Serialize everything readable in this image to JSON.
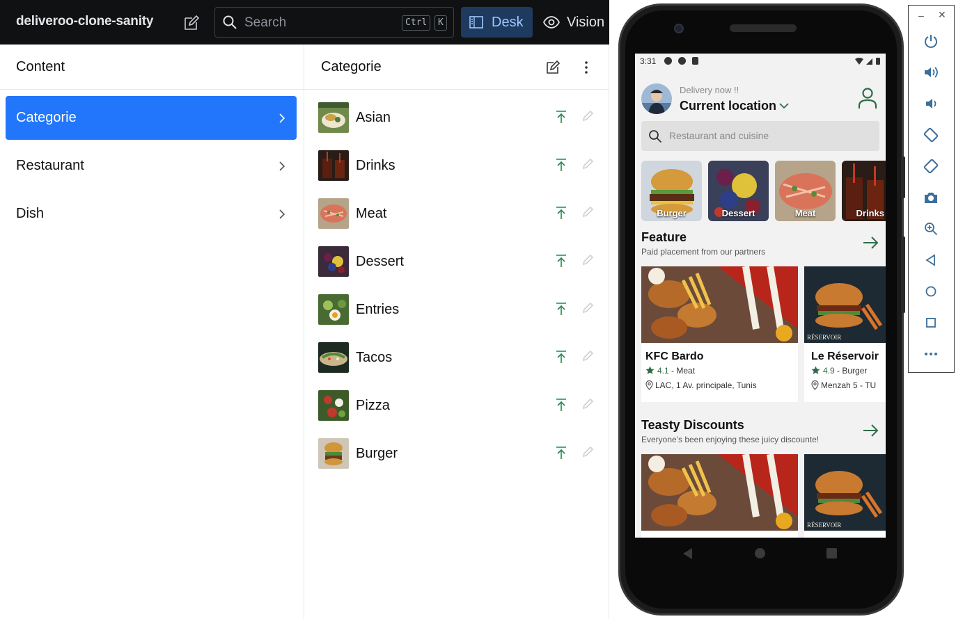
{
  "studio": {
    "project": "deliveroo-clone-sanity",
    "search_placeholder": "Search",
    "shortcut_ctrl": "Ctrl",
    "shortcut_k": "K",
    "desk_label": "Desk",
    "vision_label": "Vision"
  },
  "content_pane": {
    "title": "Content",
    "items": [
      {
        "label": "Categorie",
        "active": true
      },
      {
        "label": "Restaurant",
        "active": false
      },
      {
        "label": "Dish",
        "active": false
      }
    ]
  },
  "list_pane": {
    "title": "Categorie",
    "docs": [
      "Asian",
      "Drinks",
      "Meat",
      "Dessert",
      "Entries",
      "Tacos",
      "Pizza",
      "Burger"
    ]
  },
  "app": {
    "time": "3:31",
    "delivery_now": "Delivery now !!",
    "current_location": "Current location",
    "search_placeholder": "Restaurant and cuisine",
    "categories": [
      "Burger",
      "Dessert",
      "Meat",
      "Drinks"
    ],
    "sections": [
      {
        "title": "Feature",
        "subtitle": "Paid placement from our partners",
        "restaurants": [
          {
            "name": "KFC Bardo",
            "rating": "4.1",
            "genre": " - Meat",
            "address": "LAC, 1 Av. principale, Tunis"
          },
          {
            "name": "Le Réservoir",
            "rating": "4.9",
            "genre": " - Burger",
            "address": "Menzah 5 - TU"
          }
        ]
      },
      {
        "title": "Teasty Discounts",
        "subtitle": "Everyone's been enjoying these juicy discounte!"
      }
    ]
  },
  "colors": {
    "accent": "#2276fc",
    "publish_green": "#1f8a4c",
    "rating_green": "#2e6b46"
  }
}
